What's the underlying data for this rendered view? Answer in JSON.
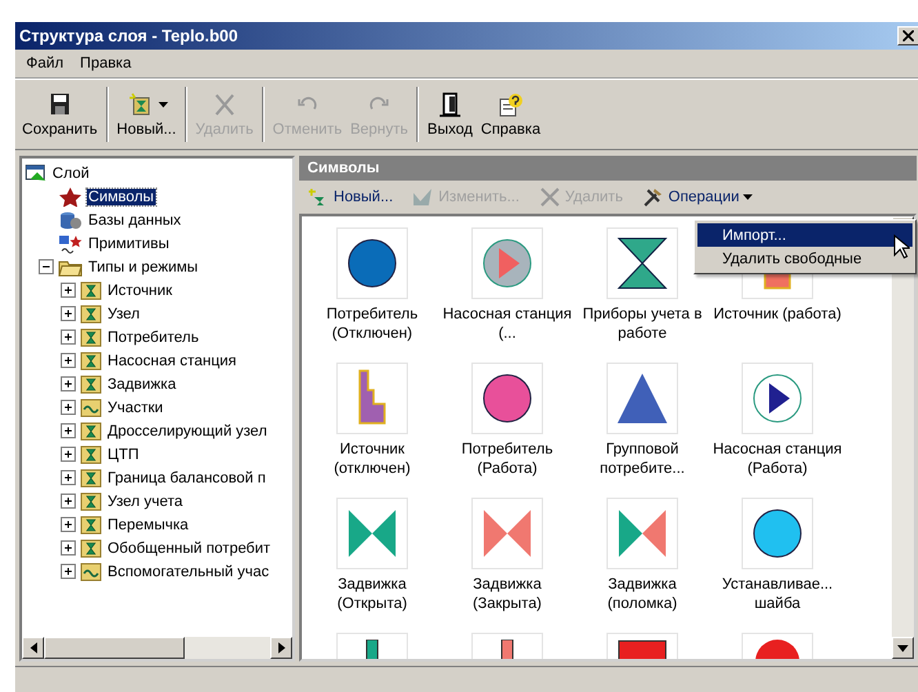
{
  "window": {
    "title": "Структура слоя - Teplo.b00"
  },
  "menu": [
    "Файл",
    "Правка"
  ],
  "toolbar": [
    [
      {
        "label": "Сохранить",
        "disabled": false,
        "kind": "button"
      }
    ],
    [
      {
        "label": "Новый...",
        "disabled": false,
        "kind": "dropdown"
      }
    ],
    [
      {
        "label": "Удалить",
        "disabled": true,
        "kind": "button"
      }
    ],
    [
      {
        "label": "Отменить",
        "disabled": true,
        "kind": "button"
      },
      {
        "label": "Вернуть",
        "disabled": true,
        "kind": "button"
      }
    ],
    [
      {
        "label": "Выход",
        "disabled": false,
        "kind": "button"
      },
      {
        "label": "Справка",
        "disabled": false,
        "kind": "button"
      }
    ]
  ],
  "tree": [
    {
      "label": "Слой",
      "selected": false,
      "children": [
        {
          "label": "Символы",
          "selected": true
        },
        {
          "label": "Базы данных",
          "selected": false
        },
        {
          "label": "Примитивы",
          "selected": false
        },
        {
          "label": "Типы и режимы",
          "selected": false,
          "expanded": true,
          "children": [
            {
              "label": "Источник",
              "kind": "type",
              "selected": false,
              "expanded": false
            },
            {
              "label": "Узел",
              "kind": "type",
              "selected": false,
              "expanded": false
            },
            {
              "label": "Потребитель",
              "kind": "type",
              "selected": false,
              "expanded": false
            },
            {
              "label": "Насосная станция",
              "kind": "type",
              "selected": false,
              "expanded": false
            },
            {
              "label": "Задвижка",
              "kind": "type",
              "selected": false,
              "expanded": false
            },
            {
              "label": "Участки",
              "kind": "section",
              "selected": false,
              "expanded": false
            },
            {
              "label": "Дросселирующий узел",
              "kind": "type",
              "selected": false,
              "expanded": false
            },
            {
              "label": "ЦТП",
              "kind": "type",
              "selected": false,
              "expanded": false
            },
            {
              "label": "Граница балансовой п",
              "kind": "type",
              "selected": false,
              "expanded": false
            },
            {
              "label": "Узел учета",
              "kind": "type",
              "selected": false,
              "expanded": false
            },
            {
              "label": "Перемычка",
              "kind": "type",
              "selected": false,
              "expanded": false
            },
            {
              "label": "Обобщенный потребит",
              "kind": "type",
              "selected": false,
              "expanded": false
            },
            {
              "label": "Вспомогательный учас",
              "kind": "section",
              "selected": false,
              "expanded": false
            }
          ]
        }
      ]
    }
  ],
  "panel": {
    "title": "Символы",
    "actions": [
      {
        "label": "Новый...",
        "disabled": false,
        "kind": "button"
      },
      {
        "label": "Изменить...",
        "disabled": true,
        "kind": "button"
      },
      {
        "label": "Удалить",
        "disabled": true,
        "kind": "button"
      },
      {
        "label": "Операции",
        "disabled": false,
        "kind": "dropdown"
      }
    ],
    "menu": [
      {
        "label": "Импорт...",
        "selected": true
      },
      {
        "label": "Удалить свободные",
        "selected": false
      }
    ],
    "symbols": [
      {
        "label": "Потребитель (Отключен)",
        "kind": "circle",
        "color": "#0a6cb8"
      },
      {
        "label": "Насосная станция (...",
        "kind": "pump-off",
        "color": "#f06060"
      },
      {
        "label": "Приборы учета в работе",
        "kind": "meter",
        "color": "#2fa88a"
      },
      {
        "label": "Источник (работа)",
        "kind": "source",
        "color": "#f07060"
      },
      {
        "label": "Источник (отключен)",
        "kind": "source",
        "color": "#a060b0"
      },
      {
        "label": "Потребитель (Работа)",
        "kind": "circle",
        "color": "#e8509a"
      },
      {
        "label": "Групповой потребите...",
        "kind": "triangle",
        "color": "#4060b8"
      },
      {
        "label": "Насосная станция (Работа)",
        "kind": "pump",
        "color": "#202090"
      },
      {
        "label": "Задвижка (Открыта)",
        "kind": "valve",
        "color": "#18a888"
      },
      {
        "label": "Задвижка (Закрыта)",
        "kind": "valve",
        "color": "#f07870"
      },
      {
        "label": "Задвижка (поломка)",
        "kind": "valve-broken",
        "color": "#18a888"
      },
      {
        "label": "Устанавливае... шайба",
        "kind": "circle",
        "color": "#20c0f0"
      },
      {
        "kind": "stub",
        "color": "#18a888"
      },
      {
        "kind": "stub",
        "color": "#f07870"
      },
      {
        "kind": "block",
        "color": "#e82020"
      },
      {
        "kind": "dome",
        "color": "#e82020"
      }
    ]
  }
}
